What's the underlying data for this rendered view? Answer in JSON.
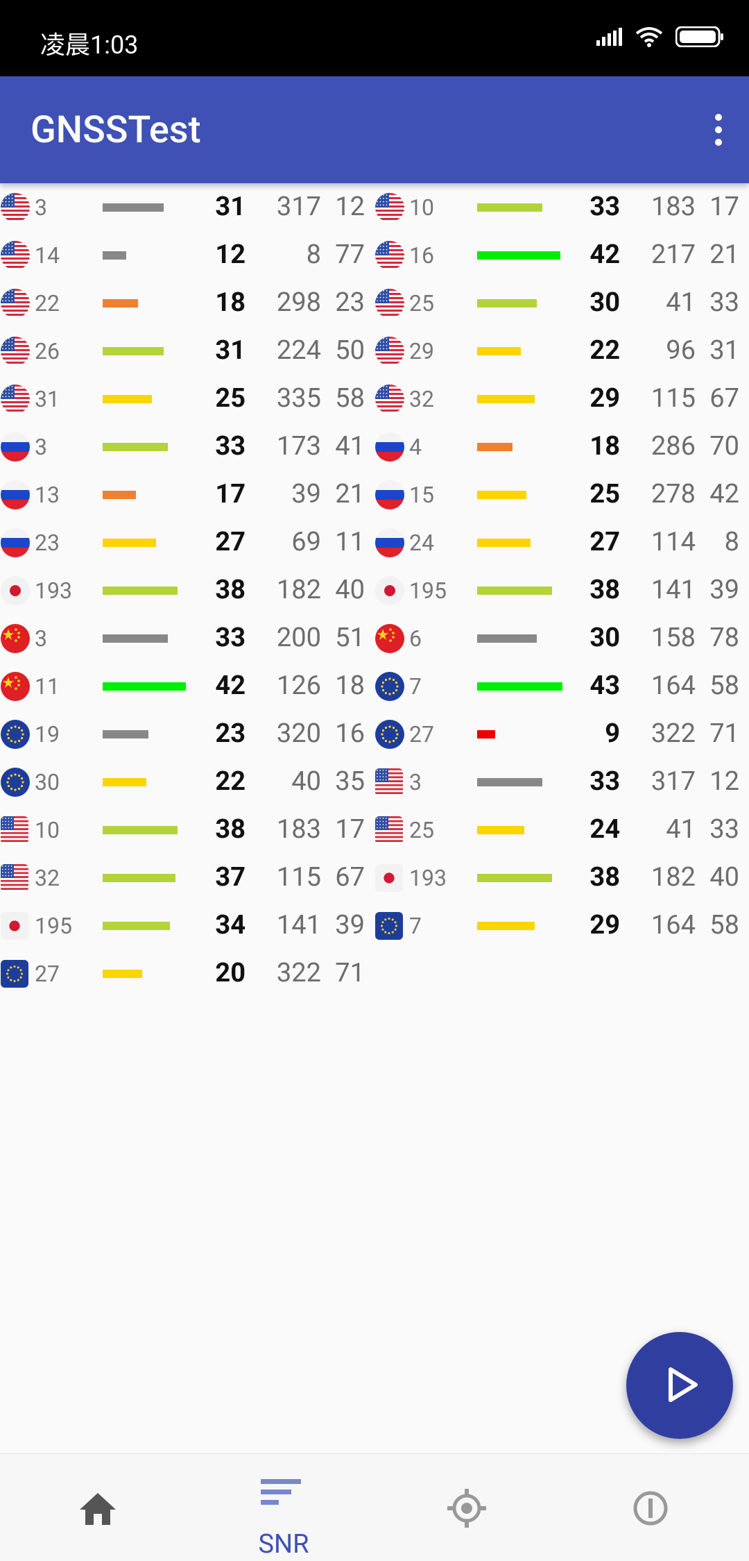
{
  "status_bar": {
    "time": "凌晨1:03"
  },
  "app": {
    "title": "GNSSTest"
  },
  "colors": {
    "app_bar": "#3f51b5",
    "fab": "#303f9f",
    "bar_gray": "#888888",
    "bar_orange": "#f08030",
    "bar_yellowgreen": "#b3d33b",
    "bar_yellow": "#ffd400",
    "bar_green": "#00ee00",
    "bar_red": "#ee0000"
  },
  "satellites": [
    {
      "flag": "us",
      "shape": "round",
      "svid": "3",
      "bar": "gray",
      "snr": "31",
      "az": "317",
      "el": "12"
    },
    {
      "flag": "us",
      "shape": "round",
      "svid": "10",
      "bar": "yellowgreen",
      "snr": "33",
      "az": "183",
      "el": "17"
    },
    {
      "flag": "us",
      "shape": "round",
      "svid": "14",
      "bar": "gray",
      "snr": "12",
      "az": "8",
      "el": "77"
    },
    {
      "flag": "us",
      "shape": "round",
      "svid": "16",
      "bar": "green",
      "snr": "42",
      "az": "217",
      "el": "21"
    },
    {
      "flag": "us",
      "shape": "round",
      "svid": "22",
      "bar": "orange",
      "snr": "18",
      "az": "298",
      "el": "23"
    },
    {
      "flag": "us",
      "shape": "round",
      "svid": "25",
      "bar": "yellowgreen",
      "snr": "30",
      "az": "41",
      "el": "33"
    },
    {
      "flag": "us",
      "shape": "round",
      "svid": "26",
      "bar": "yellowgreen",
      "snr": "31",
      "az": "224",
      "el": "50"
    },
    {
      "flag": "us",
      "shape": "round",
      "svid": "29",
      "bar": "yellow",
      "snr": "22",
      "az": "96",
      "el": "31"
    },
    {
      "flag": "us",
      "shape": "round",
      "svid": "31",
      "bar": "yellow",
      "snr": "25",
      "az": "335",
      "el": "58"
    },
    {
      "flag": "us",
      "shape": "round",
      "svid": "32",
      "bar": "yellow",
      "snr": "29",
      "az": "115",
      "el": "67"
    },
    {
      "flag": "ru",
      "shape": "round",
      "svid": "3",
      "bar": "yellowgreen",
      "snr": "33",
      "az": "173",
      "el": "41"
    },
    {
      "flag": "ru",
      "shape": "round",
      "svid": "4",
      "bar": "orange",
      "snr": "18",
      "az": "286",
      "el": "70"
    },
    {
      "flag": "ru",
      "shape": "round",
      "svid": "13",
      "bar": "orange",
      "snr": "17",
      "az": "39",
      "el": "21"
    },
    {
      "flag": "ru",
      "shape": "round",
      "svid": "15",
      "bar": "yellow",
      "snr": "25",
      "az": "278",
      "el": "42"
    },
    {
      "flag": "ru",
      "shape": "round",
      "svid": "23",
      "bar": "yellow",
      "snr": "27",
      "az": "69",
      "el": "11"
    },
    {
      "flag": "ru",
      "shape": "round",
      "svid": "24",
      "bar": "yellow",
      "snr": "27",
      "az": "114",
      "el": "8"
    },
    {
      "flag": "jp",
      "shape": "round",
      "svid": "193",
      "bar": "yellowgreen",
      "snr": "38",
      "az": "182",
      "el": "40"
    },
    {
      "flag": "jp",
      "shape": "round",
      "svid": "195",
      "bar": "yellowgreen",
      "snr": "38",
      "az": "141",
      "el": "39"
    },
    {
      "flag": "cn",
      "shape": "round",
      "svid": "3",
      "bar": "gray",
      "snr": "33",
      "az": "200",
      "el": "51"
    },
    {
      "flag": "cn",
      "shape": "round",
      "svid": "6",
      "bar": "gray",
      "snr": "30",
      "az": "158",
      "el": "78"
    },
    {
      "flag": "cn",
      "shape": "round",
      "svid": "11",
      "bar": "green",
      "snr": "42",
      "az": "126",
      "el": "18"
    },
    {
      "flag": "eu",
      "shape": "round",
      "svid": "7",
      "bar": "green",
      "snr": "43",
      "az": "164",
      "el": "58"
    },
    {
      "flag": "eu",
      "shape": "round",
      "svid": "19",
      "bar": "gray",
      "snr": "23",
      "az": "320",
      "el": "16"
    },
    {
      "flag": "eu",
      "shape": "round",
      "svid": "27",
      "bar": "red",
      "snr": "9",
      "az": "322",
      "el": "71"
    },
    {
      "flag": "eu",
      "shape": "round",
      "svid": "30",
      "bar": "yellow",
      "snr": "22",
      "az": "40",
      "el": "35"
    },
    {
      "flag": "us",
      "shape": "square",
      "svid": "3",
      "bar": "gray",
      "snr": "33",
      "az": "317",
      "el": "12"
    },
    {
      "flag": "us",
      "shape": "square",
      "svid": "10",
      "bar": "yellowgreen",
      "snr": "38",
      "az": "183",
      "el": "17"
    },
    {
      "flag": "us",
      "shape": "square",
      "svid": "25",
      "bar": "yellow",
      "snr": "24",
      "az": "41",
      "el": "33"
    },
    {
      "flag": "us",
      "shape": "square",
      "svid": "32",
      "bar": "yellowgreen",
      "snr": "37",
      "az": "115",
      "el": "67"
    },
    {
      "flag": "jp",
      "shape": "square",
      "svid": "193",
      "bar": "yellowgreen",
      "snr": "38",
      "az": "182",
      "el": "40"
    },
    {
      "flag": "jp",
      "shape": "square",
      "svid": "195",
      "bar": "yellowgreen",
      "snr": "34",
      "az": "141",
      "el": "39"
    },
    {
      "flag": "eu",
      "shape": "square",
      "svid": "7",
      "bar": "yellow",
      "snr": "29",
      "az": "164",
      "el": "58"
    },
    {
      "flag": "eu",
      "shape": "square",
      "svid": "27",
      "bar": "yellow",
      "snr": "20",
      "az": "322",
      "el": "71"
    }
  ],
  "bottom_nav": {
    "items": [
      {
        "icon": "home-icon",
        "label": ""
      },
      {
        "icon": "snr-icon",
        "label": "SNR"
      },
      {
        "icon": "gps-target-icon",
        "label": ""
      },
      {
        "icon": "info-icon",
        "label": ""
      }
    ]
  },
  "fab": {
    "icon": "play-icon"
  }
}
